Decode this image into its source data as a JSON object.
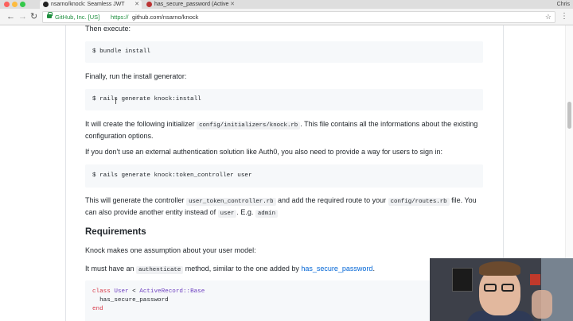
{
  "browser": {
    "tabs": [
      {
        "title": "nsarno/knock: Seamless JWT",
        "active": true
      },
      {
        "title": "has_secure_password (Active",
        "active": false
      }
    ],
    "profile": "Chris",
    "address": {
      "ev_label": "GitHub, Inc. [US]",
      "scheme": "https://",
      "path": "github.com/nsarno/knock"
    }
  },
  "content": {
    "then_execute": "Then execute:",
    "cmd_bundle": "$ bundle install",
    "finally_run": "Finally, run the install generator:",
    "cmd_generate_install": "$ rails generate knock:install",
    "initializer_pre": "It will create the following initializer ",
    "initializer_file": "config/initializers/knock.rb",
    "initializer_post": ". This file contains all the informations about the existing configuration options.",
    "auth_solution": "If you don't use an external authentication solution like Auth0, you also need to provide a way for users to sign in:",
    "cmd_token_controller": "$ rails generate knock:token_controller user",
    "controller_pre": "This will generate the controller ",
    "controller_file": "user_token_controller.rb",
    "controller_mid": " and add the required route to your ",
    "routes_file": "config/routes.rb",
    "controller_post": " file. You can also provide another entity instead of ",
    "entity_user": "user",
    "eg_text": ". E.g. ",
    "entity_admin": "admin",
    "requirements_heading": "Requirements",
    "assumption_text": "Knock makes one assumption about your user model:",
    "must_have_pre": "It must have an ",
    "authenticate_method": "authenticate",
    "must_have_mid": " method, similar to the one added by ",
    "has_secure_password_link": "has_secure_password",
    "must_have_post": ".",
    "code_class_kw": "class",
    "code_class_name": "User",
    "code_lt": " < ",
    "code_base": "ActiveRecord::Base",
    "code_line2": "  has_secure_password",
    "code_end": "end"
  },
  "colors": {
    "link": "#0366d6",
    "code_bg": "#f6f8fa",
    "secure_green": "#1e8e3e"
  }
}
